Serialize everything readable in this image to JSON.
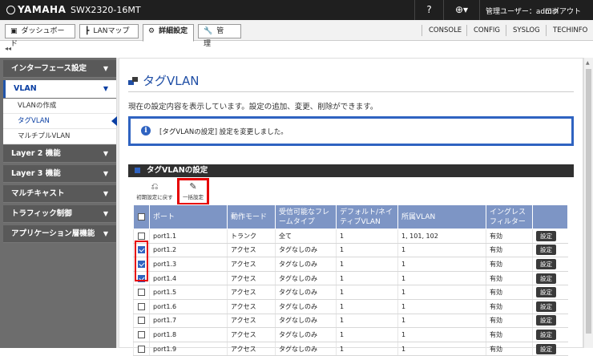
{
  "topbar": {
    "brand": "YAMAHA",
    "model": "SWX2320-16MT",
    "help": "?",
    "language": "⊕▾",
    "user": "管理ユーザー：admin",
    "logout": "ログアウト"
  },
  "menu": {
    "tabs": [
      {
        "label": "ダッシュボード",
        "icon": "dashboard-icon"
      },
      {
        "label": "LANマップ",
        "icon": "lanmap-icon"
      },
      {
        "label": "詳細設定",
        "icon": "gear-icon"
      },
      {
        "label": "管　理",
        "icon": "wrench-icon"
      }
    ],
    "links": [
      "CONSOLE",
      "CONFIG",
      "SYSLOG",
      "TECHINFO"
    ]
  },
  "collapse": "◂◂",
  "sidebar": {
    "items": [
      "インターフェース設定",
      "VLAN",
      "Layer 2 機能",
      "Layer 3 機能",
      "マルチキャスト",
      "トラフィック制御",
      "アプリケーション層機能"
    ],
    "vlan_sub": [
      "VLANの作成",
      "タグVLAN",
      "マルチプルVLAN"
    ]
  },
  "page": {
    "title": "タグVLAN",
    "description": "現在の設定内容を表示しています。設定の追加、変更、削除ができます。",
    "notice": "[タグVLANの設定] 設定を変更しました。",
    "section": "タグVLANの設定",
    "reset_label": "初期設定に戻す",
    "bulk_label": "一括設定"
  },
  "table": {
    "headers": [
      "ポート",
      "動作モード",
      "受信可能なフレームタイプ",
      "デフォルト/ネイティブVLAN",
      "所属VLAN",
      "イングレスフィルター",
      ""
    ],
    "button_label": "設定",
    "rows": [
      {
        "checked": false,
        "port": "port1.1",
        "mode": "トランク",
        "frame": "全て",
        "native": "1",
        "vlans": "1, 101, 102",
        "ingress": "有効"
      },
      {
        "checked": true,
        "port": "port1.2",
        "mode": "アクセス",
        "frame": "タグなしのみ",
        "native": "1",
        "vlans": "1",
        "ingress": "有効"
      },
      {
        "checked": true,
        "port": "port1.3",
        "mode": "アクセス",
        "frame": "タグなしのみ",
        "native": "1",
        "vlans": "1",
        "ingress": "有効"
      },
      {
        "checked": true,
        "port": "port1.4",
        "mode": "アクセス",
        "frame": "タグなしのみ",
        "native": "1",
        "vlans": "1",
        "ingress": "有効"
      },
      {
        "checked": false,
        "port": "port1.5",
        "mode": "アクセス",
        "frame": "タグなしのみ",
        "native": "1",
        "vlans": "1",
        "ingress": "有効"
      },
      {
        "checked": false,
        "port": "port1.6",
        "mode": "アクセス",
        "frame": "タグなしのみ",
        "native": "1",
        "vlans": "1",
        "ingress": "有効"
      },
      {
        "checked": false,
        "port": "port1.7",
        "mode": "アクセス",
        "frame": "タグなしのみ",
        "native": "1",
        "vlans": "1",
        "ingress": "有効"
      },
      {
        "checked": false,
        "port": "port1.8",
        "mode": "アクセス",
        "frame": "タグなしのみ",
        "native": "1",
        "vlans": "1",
        "ingress": "有効"
      },
      {
        "checked": false,
        "port": "port1.9",
        "mode": "アクセス",
        "frame": "タグなしのみ",
        "native": "1",
        "vlans": "1",
        "ingress": "有効"
      }
    ]
  },
  "colors": {
    "accent": "#2f63c1",
    "highlight": "#e60000",
    "topbar": "#1f1f1f",
    "table_header": "#7d95c5"
  }
}
